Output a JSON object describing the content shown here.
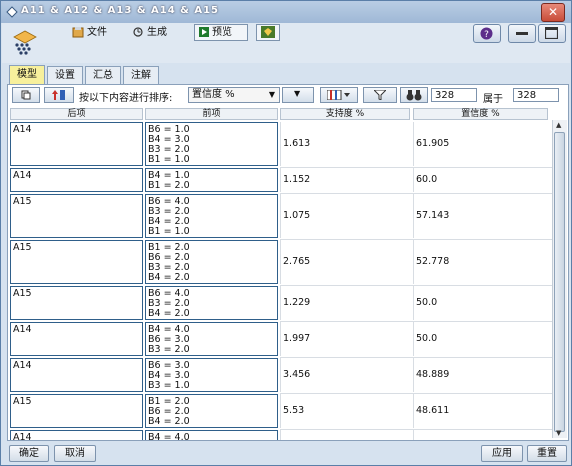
{
  "window": {
    "title": "A11 & A12 & A13 & A14 & A15",
    "close_label": "✕"
  },
  "toolbar": {
    "file_label": "文件",
    "generate_label": "生成",
    "preview_label": "预览",
    "icons": [
      "app-logo-icon",
      "file-icon",
      "generate-icon",
      "preview-play-icon",
      "gem-icon",
      "help-icon",
      "minimize-icon",
      "maximize-icon"
    ]
  },
  "tabs": [
    {
      "label": "模型",
      "active": true
    },
    {
      "label": "设置",
      "active": false
    },
    {
      "label": "汇总",
      "active": false
    },
    {
      "label": "注解",
      "active": false
    }
  ],
  "sortbar": {
    "sort_label": "按以下内容进行排序:",
    "sort_value": "置信度 %",
    "count_value": "328",
    "of_label": "属于",
    "total_value": "328"
  },
  "table": {
    "headers": {
      "consequent": "后项",
      "antecedent": "前项",
      "support": "支持度 %",
      "confidence": "置信度 %"
    },
    "rows": [
      {
        "consequent": "A14",
        "antecedent": [
          "B6 = 1.0",
          "B4 = 3.0",
          "B3 = 2.0",
          "B1 = 1.0"
        ],
        "support": "1.613",
        "confidence": "61.905"
      },
      {
        "consequent": "A14",
        "antecedent": [
          "B4 = 1.0",
          "B1 = 2.0"
        ],
        "support": "1.152",
        "confidence": "60.0"
      },
      {
        "consequent": "A15",
        "antecedent": [
          "B6 = 4.0",
          "B3 = 2.0",
          "B4 = 2.0",
          "B1 = 1.0"
        ],
        "support": "1.075",
        "confidence": "57.143"
      },
      {
        "consequent": "A15",
        "antecedent": [
          "B1 = 2.0",
          "B6 = 2.0",
          "B3 = 2.0",
          "B4 = 2.0"
        ],
        "support": "2.765",
        "confidence": "52.778"
      },
      {
        "consequent": "A15",
        "antecedent": [
          "B6 = 4.0",
          "B3 = 2.0",
          "B4 = 2.0"
        ],
        "support": "1.229",
        "confidence": "50.0"
      },
      {
        "consequent": "A14",
        "antecedent": [
          "B4 = 4.0",
          "B6 = 3.0",
          "B3 = 2.0"
        ],
        "support": "1.997",
        "confidence": "50.0"
      },
      {
        "consequent": "A14",
        "antecedent": [
          "B6 = 3.0",
          "B4 = 3.0",
          "B3 = 1.0"
        ],
        "support": "3.456",
        "confidence": "48.889"
      },
      {
        "consequent": "A15",
        "antecedent": [
          "B1 = 2.0",
          "B6 = 2.0",
          "B4 = 2.0"
        ],
        "support": "5.53",
        "confidence": "48.611"
      },
      {
        "consequent": "A14",
        "antecedent": [
          "B4 = 4.0",
          "B6 = 3.0"
        ],
        "support": "",
        "confidence": ""
      }
    ]
  },
  "footer": {
    "ok_label": "确定",
    "cancel_label": "取消",
    "apply_label": "应用",
    "reset_label": "重置"
  }
}
